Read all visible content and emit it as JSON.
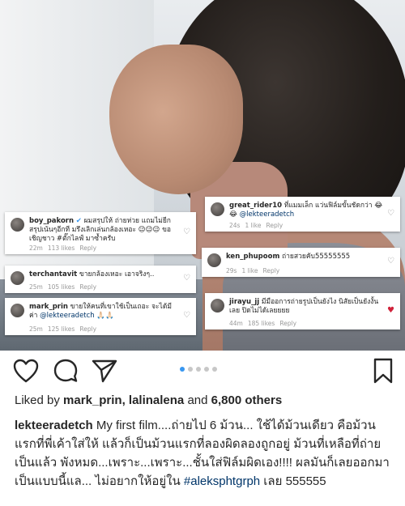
{
  "comments": [
    {
      "user": "boy_pakorn",
      "verified": true,
      "text": "ผมสรุปให้ ถ่ายห่วย แถมไม่ยีก สรุปเน้นๆอีกที มรึงเลิกเล่นกล้องเหอะ 😉😉😉 ขอเชิญชาว #ตั๊กไลฟ์ มาซ้ำครับ",
      "time": "22m",
      "likes": "113 likes",
      "reply": "Reply"
    },
    {
      "user": "great_rider10",
      "text": "ที่แมมเล็ก แว่นฟิล์มขั้นชัดกว่า 😂😂 ",
      "mention": "@lekteeradetch",
      "time": "24s",
      "likes": "1 like",
      "reply": "Reply"
    },
    {
      "user": "ken_phupoom",
      "text": "ถ่ายสวยคับ55555555",
      "time": "29s",
      "likes": "1 like",
      "reply": "Reply"
    },
    {
      "user": "terchantavit",
      "text": "ขายกล้องเหอะ เอาจริงๆ..",
      "time": "25m",
      "likes": "105 likes",
      "reply": "Reply"
    },
    {
      "user": "mark_prin",
      "text": "ขายให้คนที่เขาใช้เป็นเถอะ จะได้มีค่า",
      "mention": "@lekteeradetch",
      "emoji": "🙏🏻🙏🏻",
      "time": "25m",
      "likes": "125 likes",
      "reply": "Reply"
    },
    {
      "user": "jirayu_jj",
      "text": "มีมืออการถ่ายรูปเป็นยังไง นิสัยเป็นยังงั้นเลย ปิดไม่ได้เลยยยย",
      "time": "44m",
      "likes": "185 likes",
      "reply": "Reply"
    }
  ],
  "actions": {
    "like": "heart-outline",
    "comment": "comment-bubble",
    "share": "send-paper-plane",
    "save": "bookmark"
  },
  "carousel": {
    "count": 5,
    "active": 1
  },
  "likes": {
    "prefix": "Liked by ",
    "users": "mark_prin, lalinalena",
    "middle": " and ",
    "others": "6,800 others"
  },
  "caption": {
    "user": "lekteeradetch",
    "text": " My first film....ถ่ายไป 6 ม้วน... ใช้ได้ม้วนเดียว คือม้วนแรกที่พี่เค้าใส่ให้ แล้วก็เป็นม้วนแรกที่ลองผิดลองถูกอยู่ ม้วนที่เหลือที่ถ่ายเป็นแล้ว พังหมด...เพราะ...เพราะ...ชั้นใส่ฟิล์มผิดเอง!!!! ผลมันก็เลยออกมาเป็นแบบนี้แล... ไม่อยากให้อยู่ใน ",
    "hashtag": "#aleksphtgrph",
    "tail": " เลย 555555"
  },
  "colors": {
    "link": "#003569",
    "accent": "#3897f0",
    "heart": "#d0213a"
  }
}
